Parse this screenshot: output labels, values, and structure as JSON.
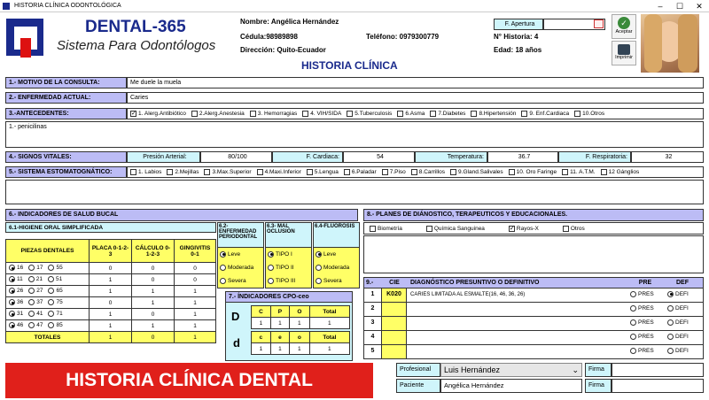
{
  "window": {
    "title": "HISTORIA CLÍNICA ODONTOLÓGICA"
  },
  "brand": {
    "name": "DENTAL-365",
    "tagline": "Sistema Para Odontólogos"
  },
  "patient": {
    "nombre": "Nombre: Angélica Hernández",
    "cedula": "Cédula:98989898",
    "telefono": "Teléfono: 0979300779",
    "direccion": "Dirección: Quito-Ecuador",
    "historia": "N° Historia: 4",
    "edad": "Edad: 18 años"
  },
  "header": {
    "apertura_label": "F. Apertura",
    "apertura_value": "",
    "aceptar": "Aceptar",
    "imprimir": "Imprimir",
    "heading": "HISTORIA CLÍNICA"
  },
  "s1": {
    "label": "1.- MOTIVO DE LA CONSULTA:",
    "value": "Me duele la muela"
  },
  "s2": {
    "label": "2.- ENFERMEDAD ACTUAL:",
    "value": "Caries"
  },
  "s3": {
    "label": "3.-ANTECEDENTES:",
    "options": [
      {
        "label": "1. Alerg.Antibiótico",
        "checked": true
      },
      {
        "label": "2.Alerg.Anestesia",
        "checked": false
      },
      {
        "label": "3. Hemorragias",
        "checked": false
      },
      {
        "label": "4. VIH/SIDA",
        "checked": false
      },
      {
        "label": "5.Tuberculosis",
        "checked": false
      },
      {
        "label": "6.Asma",
        "checked": false
      },
      {
        "label": "7.Diabetes",
        "checked": false
      },
      {
        "label": "8.Hipertensión",
        "checked": false
      },
      {
        "label": "9. Enf.Cardiaca",
        "checked": false
      },
      {
        "label": "10.Otros",
        "checked": false
      }
    ],
    "notes": "1.- penicilinas"
  },
  "s4": {
    "label": "4.- SIGNOS VITALES:",
    "presion_label": "Presión Arterial:",
    "presion": "80/100",
    "cardiaca_label": "F. Cardiaca:",
    "cardiaca": "54",
    "temp_label": "Temperatura:",
    "temp": "36.7",
    "resp_label": "F. Respiratoria:",
    "resp": "32"
  },
  "s5": {
    "label": "5.- SISTEMA ESTOMATOGNÁTICO:",
    "options": [
      "1. Labios",
      "2.Mejillas",
      "3.Max.Superior",
      "4.Maxi.Inferior",
      "5.Lengua",
      "6.Paladar",
      "7.Piso",
      "8.Carrillos",
      "9.Gland.Salivales",
      "10. Oro Faringe",
      "11. A.T.M.",
      "12 Gánglios"
    ]
  },
  "s6": {
    "label": "6.- INDICADORES DE SALUD BUCAL",
    "sub": "6.1-HIGIENE ORAL SIMPLIFICADA",
    "col_piezas": "PIEZAS DENTALES",
    "col_placa": "PLACA 0-1-2-3",
    "col_calculo": "CÁLCULO 0-1-2-3",
    "col_gingivitis": "GINGIVITIS 0-1",
    "rows": [
      {
        "a": "16",
        "b": "17",
        "c": "55",
        "placa": "0",
        "calculo": "0",
        "ging": "0"
      },
      {
        "a": "11",
        "b": "21",
        "c": "51",
        "placa": "1",
        "calculo": "0",
        "ging": "0"
      },
      {
        "a": "26",
        "b": "27",
        "c": "65",
        "placa": "1",
        "calculo": "1",
        "ging": "1"
      },
      {
        "a": "36",
        "b": "37",
        "c": "75",
        "placa": "0",
        "calculo": "1",
        "ging": "1"
      },
      {
        "a": "31",
        "b": "41",
        "c": "71",
        "placa": "1",
        "calculo": "0",
        "ging": "1"
      },
      {
        "a": "46",
        "b": "47",
        "c": "85",
        "placa": "1",
        "calculo": "1",
        "ging": "1"
      }
    ],
    "totales_label": "TOTALES",
    "tot_placa": "1",
    "tot_calculo": "0",
    "tot_ging": "1",
    "perio": {
      "title": "6.2-ENFERMEDAD PERIODONTAL",
      "opts": [
        "Leve",
        "Moderada",
        "Severa"
      ]
    },
    "oclusion": {
      "title": "6.3- MAL OCLUSIÓN",
      "opts": [
        "TIPO I",
        "TIPO II",
        "TIPO III"
      ]
    },
    "fluorosis": {
      "title": "6.4-FLUOROSIS",
      "opts": [
        "Leve",
        "Moderada",
        "Severa"
      ]
    }
  },
  "s7": {
    "label": "7.- ÍNDICADORES CPO-ceo",
    "D": "D",
    "d": "d",
    "h1": [
      "C",
      "P",
      "O",
      "Total"
    ],
    "r1": [
      "1",
      "1",
      "1",
      "1"
    ],
    "h2": [
      "c",
      "e",
      "o",
      "Total"
    ],
    "r2": [
      "1",
      "1",
      "1",
      "1"
    ]
  },
  "s8": {
    "label": "8.- PLANES DE DIÁNOSTICO, TERAPEUTICOS Y EDUCACIONALES.",
    "options": [
      {
        "label": "Biometría",
        "checked": false
      },
      {
        "label": "Química Sanguinea",
        "checked": false
      },
      {
        "label": "Rayos-X",
        "checked": true
      },
      {
        "label": "Otros",
        "checked": false
      }
    ]
  },
  "s9": {
    "label": "9.-",
    "cie": "CIE",
    "diag": "DIAGNÓSTICO PRESUNTIVO O DEFINITIVO",
    "pre": "PRE",
    "def": "DEF",
    "pres": "PRES",
    "defi": "DEFI",
    "rows": [
      {
        "n": "1",
        "cie": "K020",
        "text": "CARIES LIMITADA AL ESMALTE(16, 46, 36, 26)"
      },
      {
        "n": "2",
        "cie": "",
        "text": ""
      },
      {
        "n": "3",
        "cie": "",
        "text": ""
      },
      {
        "n": "4",
        "cie": "",
        "text": ""
      },
      {
        "n": "5",
        "cie": "",
        "text": ""
      }
    ]
  },
  "footer": {
    "banner": "HISTORIA CLÍNICA DENTAL",
    "profesional_label": "Profesional",
    "profesional": "Luis Hernández",
    "paciente_label": "Paciente",
    "paciente": "Angélica Hernández",
    "firma": "Firma"
  },
  "colors": {
    "purple": "#bcbcf5",
    "cyan": "#cff5fb",
    "yellow": "#ffff66",
    "banner": "#e0201b",
    "brand_blue": "#1a2a8c"
  }
}
